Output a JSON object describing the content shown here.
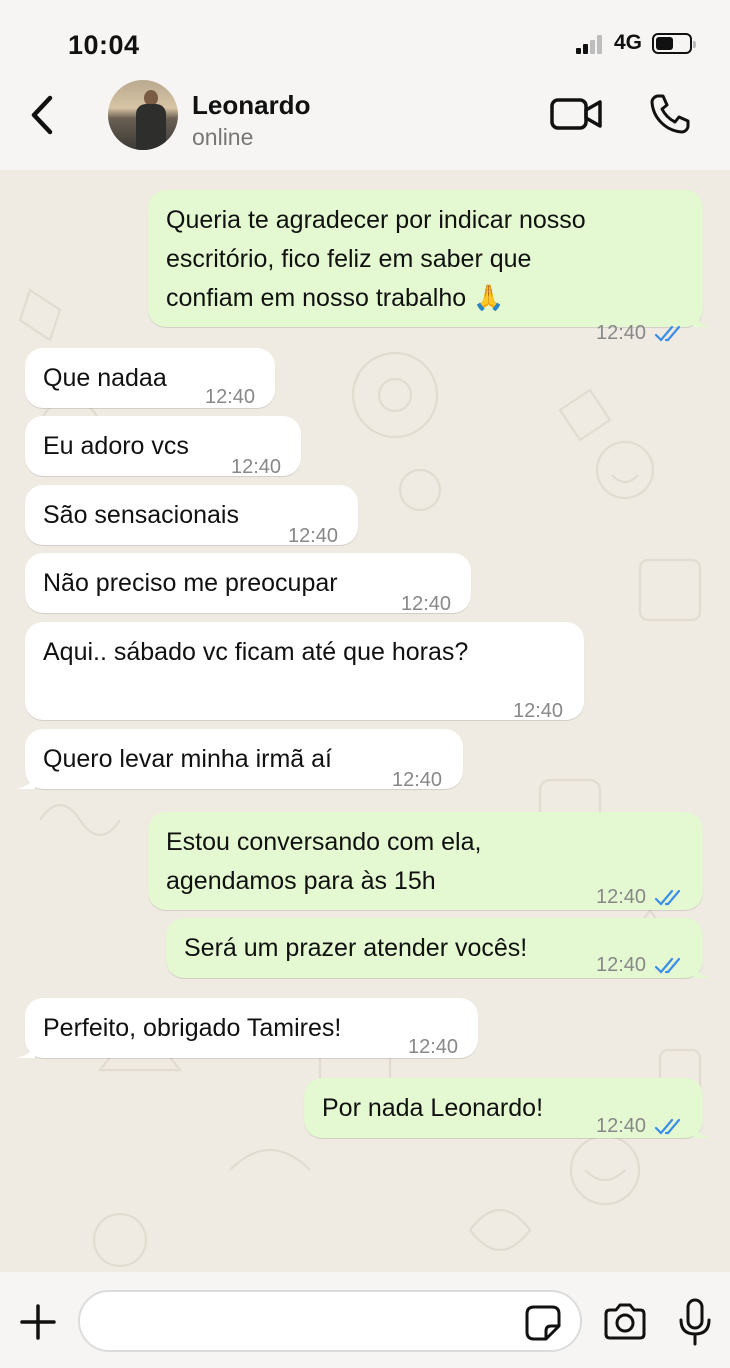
{
  "status_bar": {
    "time": "10:04",
    "network": "4G"
  },
  "header": {
    "name": "Leonardo",
    "status": "online"
  },
  "colors": {
    "outgoing_bubble": "#e4f9d1",
    "incoming_bubble": "#ffffff",
    "read_ticks": "#3b8ee8",
    "background": "#efeae2"
  },
  "messages": [
    {
      "dir": "out",
      "lines": [
        "Queria te agradecer por indicar nosso",
        "escritório, fico feliz em saber que",
        "confiam em nosso trabalho 🙏"
      ],
      "time": "12:40",
      "read": true
    },
    {
      "dir": "in",
      "lines": [
        "Que nadaa"
      ],
      "time": "12:40"
    },
    {
      "dir": "in",
      "lines": [
        "Eu adoro vcs"
      ],
      "time": "12:40"
    },
    {
      "dir": "in",
      "lines": [
        "São sensacionais"
      ],
      "time": "12:40"
    },
    {
      "dir": "in",
      "lines": [
        "Não preciso me preocupar"
      ],
      "time": "12:40"
    },
    {
      "dir": "in",
      "lines": [
        "Aqui.. sábado vc ficam até que horas?"
      ],
      "time": "12:40"
    },
    {
      "dir": "in",
      "lines": [
        "Quero levar minha irmã aí"
      ],
      "time": "12:40"
    },
    {
      "dir": "out",
      "lines": [
        "Estou conversando com ela,",
        "agendamos para às 15h"
      ],
      "time": "12:40",
      "read": true
    },
    {
      "dir": "out",
      "lines": [
        "Será um prazer atender vocês!"
      ],
      "time": "12:40",
      "read": true
    },
    {
      "dir": "in",
      "lines": [
        "Perfeito, obrigado Tamires!"
      ],
      "time": "12:40"
    },
    {
      "dir": "out",
      "lines": [
        "Por nada Leonardo!"
      ],
      "time": "12:40",
      "read": true
    }
  ],
  "input": {
    "placeholder": ""
  },
  "icons": [
    "back-icon",
    "video-call-icon",
    "phone-call-icon",
    "plus-icon",
    "sticker-icon",
    "camera-icon",
    "microphone-icon",
    "double-check-icon"
  ]
}
